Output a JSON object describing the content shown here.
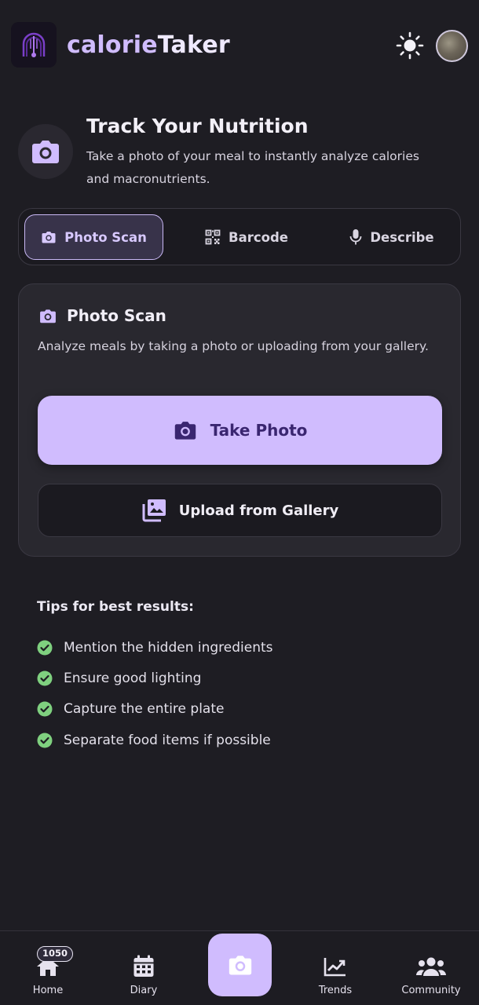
{
  "app": {
    "title_part1": "calorie",
    "title_part2": "Taker"
  },
  "intro": {
    "title": "Track Your Nutrition",
    "description": "Take a photo of your meal to instantly analyze calories and macronutrients."
  },
  "tabs": [
    {
      "label": "Photo Scan",
      "icon": "camera-icon",
      "active": true
    },
    {
      "label": "Barcode",
      "icon": "qr-code-icon",
      "active": false
    },
    {
      "label": "Describe",
      "icon": "microphone-icon",
      "active": false
    }
  ],
  "card": {
    "title": "Photo Scan",
    "description": "Analyze meals by taking a photo or uploading from your gallery.",
    "primary_button": "Take Photo",
    "secondary_button": "Upload from Gallery"
  },
  "tips": {
    "title": "Tips for best results:",
    "items": [
      "Mention the hidden ingredients",
      "Ensure good lighting",
      "Capture the entire plate",
      "Separate food items if possible"
    ]
  },
  "nav": {
    "home": "Home",
    "home_badge": "1050",
    "diary": "Diary",
    "trends": "Trends",
    "community": "Community"
  },
  "colors": {
    "background": "#1e1d23",
    "accent": "#d0bcfe",
    "accent_text": "#3a2670",
    "check_green": "#7fd07f"
  }
}
